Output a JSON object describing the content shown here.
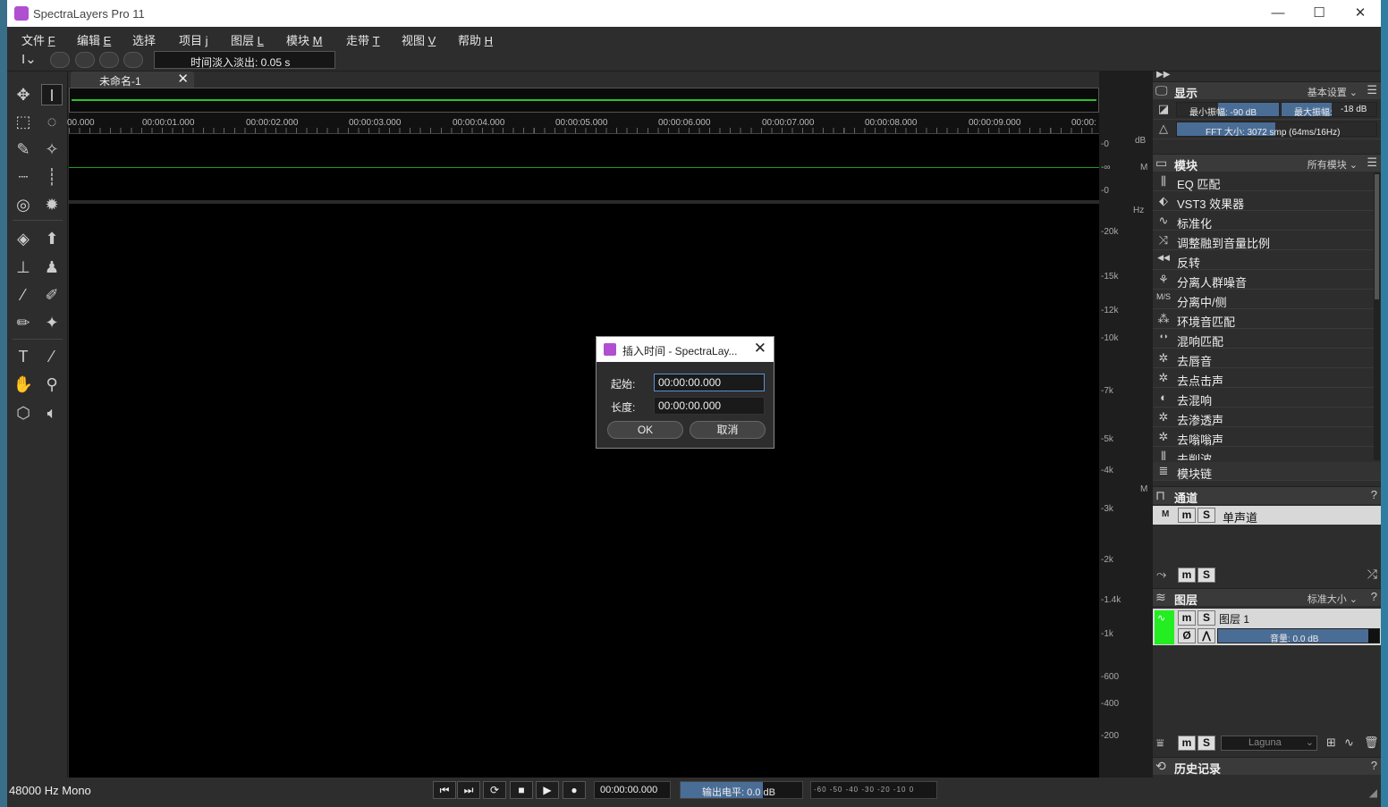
{
  "window": {
    "title": "SpectraLayers Pro 11",
    "minimize": "—",
    "maximize": "☐",
    "close": "✕"
  },
  "menu": [
    {
      "label": "文件",
      "key": "F"
    },
    {
      "label": "编辑",
      "key": "E"
    },
    {
      "label": "选择",
      "key": ""
    },
    {
      "label": "项目",
      "key": "j"
    },
    {
      "label": "图层",
      "key": "L"
    },
    {
      "label": "模块",
      "key": "M"
    },
    {
      "label": "走带",
      "key": "T"
    },
    {
      "label": "视图",
      "key": "V"
    },
    {
      "label": "帮助",
      "key": "H"
    }
  ],
  "toolbar": {
    "fade_label": "时间淡入淡出:  0.05 s"
  },
  "document": {
    "tab_label": "未命名-1",
    "tab_close": "✕",
    "timeline": [
      "00.000",
      "00:00:01.000",
      "00:00:02.000",
      "00:00:03.000",
      "00:00:04.000",
      "00:00:05.000",
      "00:00:06.000",
      "00:00:07.000",
      "00:00:08.000",
      "00:00:09.000",
      "00:00:"
    ],
    "db_labels": [
      "-0",
      "dB",
      "-∞",
      "M",
      "-0"
    ],
    "hz_labels": [
      "Hz",
      "-20k",
      "-15k",
      "-12k",
      "-10k",
      "-7k",
      "-5k",
      "-4k",
      "M",
      "-3k",
      "-2k",
      "-1.4k",
      "-1k",
      "-600",
      "-400",
      "-200"
    ]
  },
  "dialog": {
    "title": "插入时间 - SpectraLay...",
    "close": "✕",
    "start_label": "起始:",
    "start_value": "00:00:00.000",
    "length_label": "长度:",
    "length_value": "00:00:00.000",
    "ok_label": "OK",
    "cancel_label": "取消"
  },
  "panels": {
    "display": {
      "title": "显示",
      "preset": "基本设置",
      "min_amp": "最小振幅: -90 dB",
      "max_amp": "最大振幅:",
      "max_amp_value": "-18 dB",
      "fft": "FFT 大小: 3072 smp (64ms/16Hz)"
    },
    "modules": {
      "title": "模块",
      "filter": "所有模块",
      "items": [
        "EQ 匹配",
        "VST3 效果器",
        "标准化",
        "调整融到音量比例",
        "反转",
        "分离人群噪音",
        "分离中/侧",
        "环境音匹配",
        "混响匹配",
        "去唇音",
        "去点击声",
        "去混响",
        "去渗透声",
        "去嗡嗡声",
        "去削波"
      ],
      "icons": [
        "eq-match-icon",
        "vst3-icon",
        "normalize-icon",
        "adjust-loudness-icon",
        "reverse-icon",
        "crowd-noise-icon",
        "mid-side-icon",
        "ambience-match-icon",
        "reverb-match-icon",
        "de-mouth-icon",
        "de-click-icon",
        "de-reverb-icon",
        "de-bleed-icon",
        "de-hum-icon",
        "de-clip-icon"
      ],
      "chain": "模块链"
    },
    "channels": {
      "title": "通道",
      "m": "M",
      "mm": "m",
      "s": "S",
      "channel_name": "单声道"
    },
    "layers": {
      "title": "图层",
      "size": "标准大小",
      "layer_name": "图层 1",
      "volume": "音量: 0.0 dB",
      "blend": "Laguna",
      "m": "m",
      "s": "S"
    },
    "history": {
      "title": "历史记录"
    }
  },
  "status": {
    "sample_rate": "48000 Hz Mono",
    "time": "00:00:00.000",
    "output_level": "输出电平: 0.0 dB",
    "meter_scale": "-60 -50 -40 -30 -20 -10 0"
  },
  "colors": {
    "accent": "#4a6d96",
    "wave": "#2fbf2f",
    "layer": "#22ee22"
  }
}
